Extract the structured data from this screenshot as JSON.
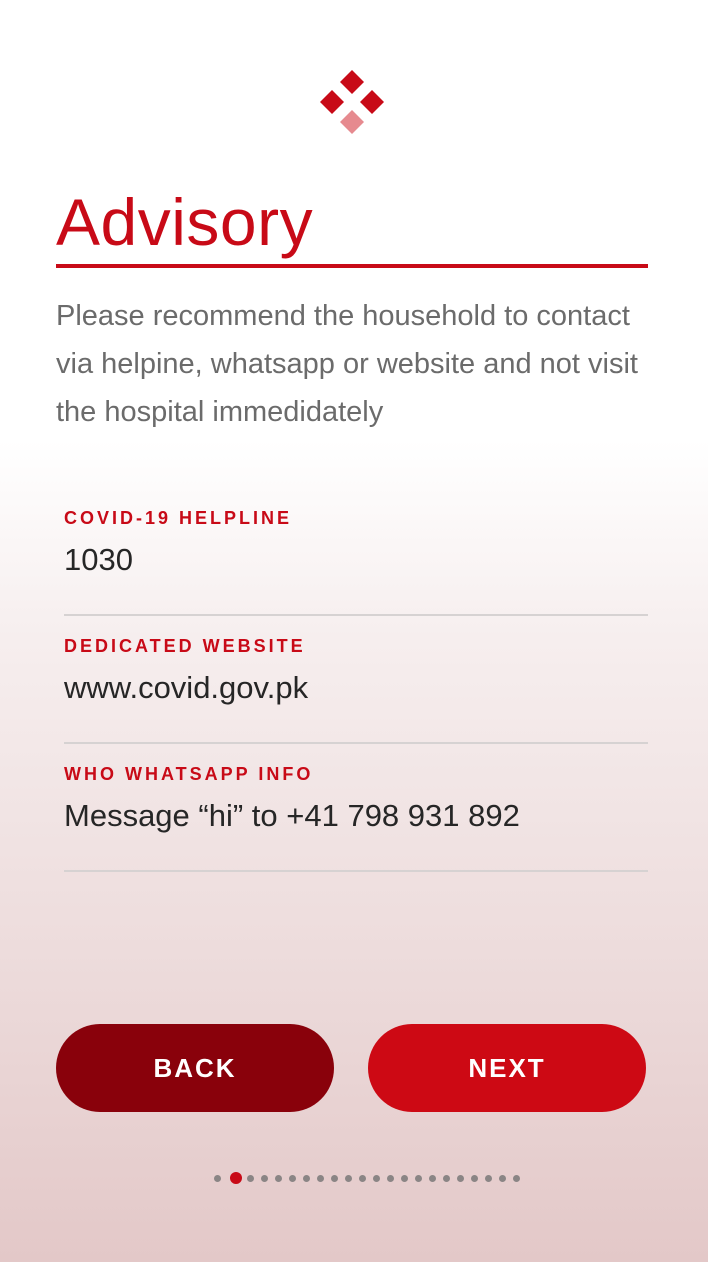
{
  "logo": {
    "icon": "diamond-cluster-icon",
    "color_primary": "#c80a17",
    "color_secondary": "#e68a8f"
  },
  "header": {
    "title": "Advisory",
    "description": "Please recommend the household to contact via helpine, whatsapp or website and not visit the hospital immedidately"
  },
  "fields": [
    {
      "label": "COVID-19 HELPLINE",
      "value": "1030"
    },
    {
      "label": "DEDICATED WEBSITE",
      "value": "www.covid.gov.pk"
    },
    {
      "label": "WHO WHATSAPP INFO",
      "value": "Message “hi” to +41 798 931 892"
    }
  ],
  "actions": {
    "back_label": "BACK",
    "next_label": "NEXT"
  },
  "pager": {
    "total_pages": 22,
    "current_page": 2,
    "active_color": "#c80a17",
    "inactive_color": "#8a8585"
  }
}
